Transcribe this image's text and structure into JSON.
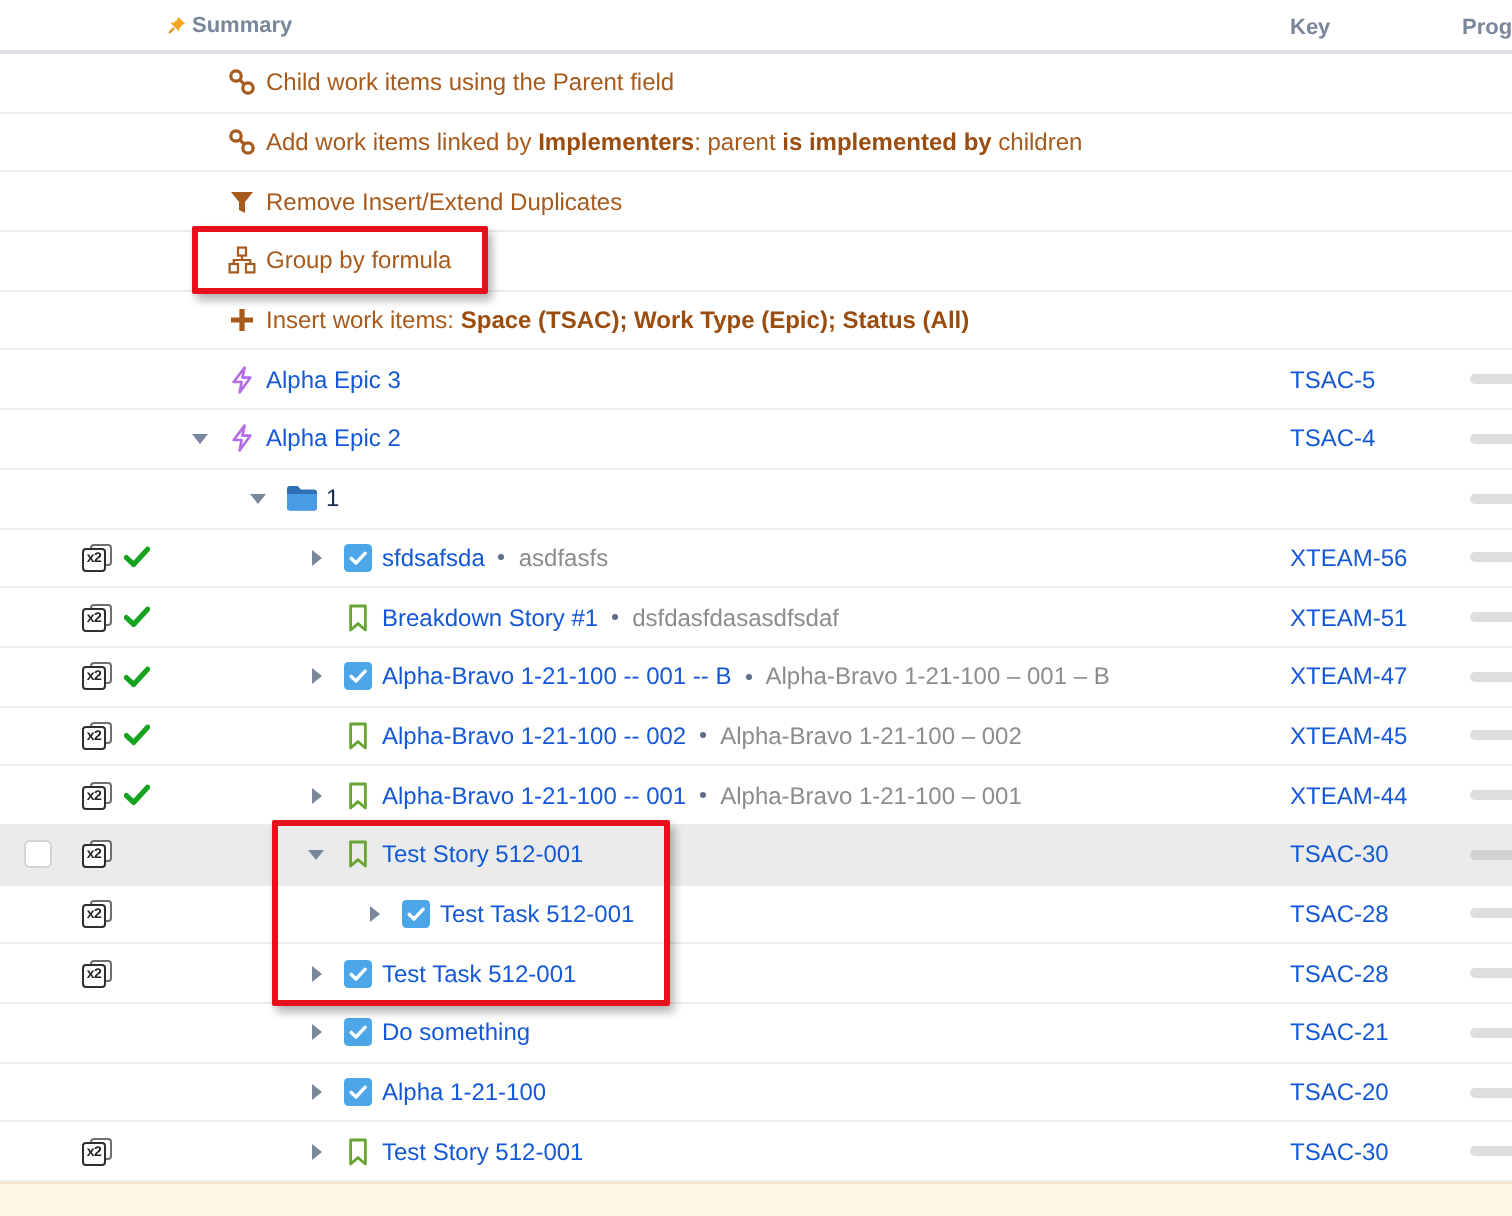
{
  "header": {
    "summary": "Summary",
    "key": "Key",
    "column_3": "Prog"
  },
  "rows": [
    {
      "kind": "extend",
      "text": "Child work items using the Parent field",
      "selected": false,
      "framed": false
    },
    {
      "kind": "extend",
      "text": "Add work items linked by **Implementers**: parent **is implemented by** children",
      "selected": false,
      "framed": false
    },
    {
      "kind": "filter",
      "text": "Remove Insert/Extend Duplicates",
      "selected": false,
      "framed": false
    },
    {
      "kind": "group",
      "text": "Group by formula",
      "selected": false,
      "framed": true
    },
    {
      "kind": "insert",
      "text": "Insert work items: **Space (TSAC); Work Type (Epic); Status (All)**",
      "selected": false,
      "framed": false
    },
    {
      "kind": "epic",
      "summary": "Alpha Epic 3",
      "key": "TSAC-5",
      "resolved": false,
      "selected": false,
      "framed": false
    },
    {
      "kind": "epic",
      "summary": "Alpha Epic 2",
      "key": "TSAC-4",
      "expanded": true,
      "resolved": false,
      "selected": false,
      "framed": false,
      "children": [
        {
          "kind": "folder",
          "summary": "1",
          "expanded": true,
          "selected": false,
          "framed": false,
          "children": [
            {
              "kind": "task",
              "summary": "sfdsafsda",
              "description": "asdfasfs",
              "key": "XTEAM-56",
              "expanded": false,
              "duplicates": "x2",
              "resolved": true,
              "selected": false,
              "framed": false
            },
            {
              "kind": "story",
              "summary": "Breakdown Story #1",
              "description": "dsfdasfdasasdfsdaf",
              "key": "XTEAM-51",
              "duplicates": "x2",
              "resolved": true,
              "selected": false,
              "framed": false
            },
            {
              "kind": "task",
              "summary": "Alpha-Bravo 1-21-100 -- 001 -- B",
              "description": "Alpha-Bravo 1-21-100 – 001 – B",
              "key": "XTEAM-47",
              "expanded": false,
              "duplicates": "x2",
              "resolved": true,
              "selected": false,
              "framed": false
            },
            {
              "kind": "story",
              "summary": "Alpha-Bravo 1-21-100 -- 002",
              "description": "Alpha-Bravo 1-21-100 – 002",
              "key": "XTEAM-45",
              "duplicates": "x2",
              "resolved": true,
              "selected": false,
              "framed": false
            },
            {
              "kind": "story",
              "summary": "Alpha-Bravo 1-21-100 -- 001",
              "description": "Alpha-Bravo 1-21-100 – 001",
              "key": "XTEAM-44",
              "expanded": false,
              "duplicates": "x2",
              "resolved": true,
              "selected": false,
              "framed": false
            },
            {
              "kind": "story",
              "summary": "Test Story 512-001",
              "key": "TSAC-30",
              "expanded": true,
              "duplicates": "x2",
              "resolved": false,
              "selected": true,
              "framed": true,
              "children": [
                {
                  "kind": "task",
                  "summary": "Test Task 512-001",
                  "key": "TSAC-28",
                  "expanded": false,
                  "duplicates": "x2",
                  "resolved": false,
                  "selected": false,
                  "framed": true
                }
              ]
            },
            {
              "kind": "task",
              "summary": "Test Task 512-001",
              "key": "TSAC-28",
              "expanded": false,
              "duplicates": "x2",
              "resolved": false,
              "selected": false,
              "framed": true
            },
            {
              "kind": "task",
              "summary": "Do something",
              "key": "TSAC-21",
              "expanded": false,
              "resolved": false,
              "selected": false,
              "framed": false
            },
            {
              "kind": "task",
              "summary": "Alpha 1-21-100",
              "key": "TSAC-20",
              "expanded": false,
              "resolved": false,
              "selected": false,
              "framed": false
            },
            {
              "kind": "story",
              "summary": "Test Story 512-001",
              "key": "TSAC-30",
              "expanded": false,
              "duplicates": "x2",
              "resolved": false,
              "selected": false,
              "framed": false
            }
          ]
        }
      ]
    }
  ]
}
